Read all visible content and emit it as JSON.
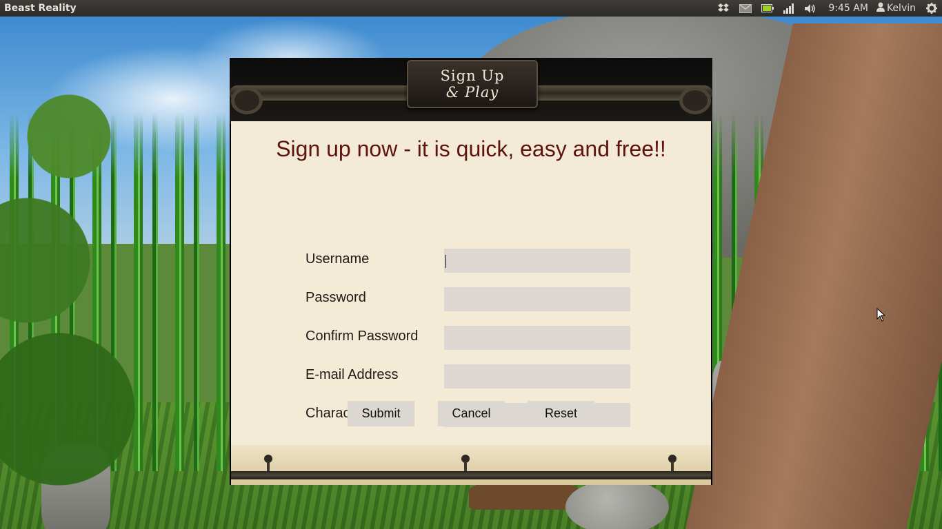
{
  "panel": {
    "app_title": "Beast Reality",
    "clock": "9:45 AM",
    "user": "Kelvin",
    "icons": [
      "dropbox-icon",
      "mail-icon",
      "battery-icon",
      "signal-icon",
      "volume-icon",
      "user-icon",
      "gear-icon"
    ]
  },
  "dialog": {
    "plaque_line1": "Sign Up",
    "plaque_line2": "& Play",
    "headline": "Sign up now - it is quick, easy and free!!",
    "fields": [
      {
        "label": "Username",
        "value": ""
      },
      {
        "label": "Password",
        "value": ""
      },
      {
        "label": "Confirm Password",
        "value": ""
      },
      {
        "label": "E-mail Address",
        "value": ""
      },
      {
        "label": "Character Name",
        "value": ""
      }
    ],
    "buttons": {
      "submit": "Submit",
      "cancel": "Cancel",
      "reset": "Reset"
    }
  },
  "colors": {
    "headline": "#5e1212",
    "parchment": "#f4ebd6",
    "input_bg": "#dcd7d0",
    "panel_bg": "#3f3e3a"
  }
}
